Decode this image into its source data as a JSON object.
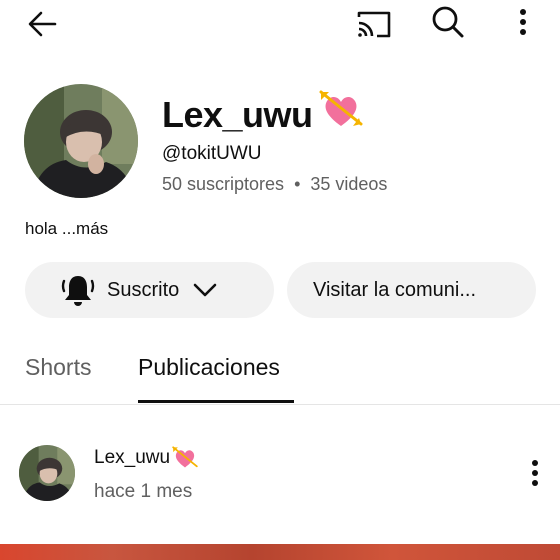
{
  "topbar": {
    "back_icon": "arrow-left-icon",
    "cast_icon": "cast-icon",
    "search_icon": "search-icon",
    "more_icon": "more-vertical-icon"
  },
  "channel": {
    "name": "Lex_uwu",
    "name_emoji": "heart-with-arrow-emoji",
    "handle": "@tokitUWU",
    "subscribers": "50 suscriptores",
    "separator": "•",
    "videos": "35 videos",
    "description": "hola",
    "description_more": "...más"
  },
  "actions": {
    "subscribed_label": "Suscrito",
    "bell_icon": "bell-icon",
    "chevron_icon": "chevron-down-icon",
    "visit_label": "Visitar la comuni..."
  },
  "tabs": [
    {
      "label": "Shorts",
      "active": false
    },
    {
      "label": "Publicaciones",
      "active": true
    }
  ],
  "post": {
    "author": "Lex_uwu",
    "time": "hace 1 mes",
    "more_icon": "more-vertical-icon"
  },
  "colors": {
    "text_primary": "#0f0f0f",
    "text_secondary": "#606060",
    "pill_bg": "#f2f2f2",
    "heart": "#f2709c",
    "arrow": "#f5b400"
  }
}
